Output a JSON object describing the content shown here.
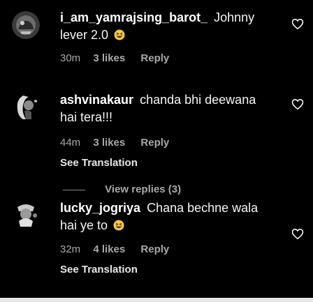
{
  "comments": [
    {
      "username": "i_am_yamrajsing_barot_",
      "text": "Johnny lever 2.0",
      "emoji_icon": "grinning-squinting-face-icon",
      "time": "30m",
      "likes": "3 likes",
      "reply": "Reply"
    },
    {
      "username": "ashvinakaur",
      "text": "chanda bhi deewana hai tera!!!",
      "time": "44m",
      "likes": "3 likes",
      "reply": "Reply",
      "translation": "See Translation"
    },
    {
      "username": "lucky_jogriya",
      "text": "Chana bechne wala hai ye to",
      "emoji_icon": "grinning-squinting-face-icon",
      "time": "32m",
      "likes": "4 likes",
      "reply": "Reply",
      "translation": "See Translation"
    }
  ],
  "view_replies": "View replies (3)",
  "icons": {
    "like": "heart-outline-icon"
  },
  "colors": {
    "background": "#000000",
    "text": "#ffffff",
    "meta": "#a8a8a8"
  }
}
